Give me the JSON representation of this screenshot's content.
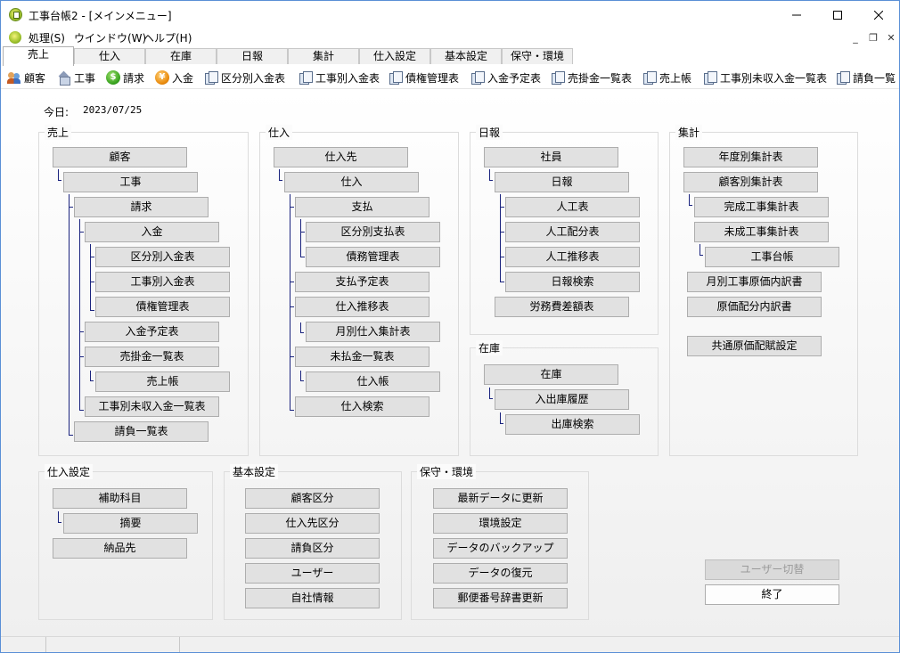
{
  "window": {
    "title": "工事台帳2 - [メインメニュー]"
  },
  "menu": {
    "items": [
      "処理(S)",
      "ウインドウ(W)",
      "ヘルプ(H)"
    ]
  },
  "tabs": [
    "売上",
    "仕入",
    "在庫",
    "日報",
    "集計",
    "仕入設定",
    "基本設定",
    "保守・環境"
  ],
  "toolbar": [
    "顧客",
    "工事",
    "請求",
    "入金",
    "区分別入金表",
    "工事別入金表",
    "債権管理表",
    "入金予定表",
    "売掛金一覧表",
    "売上帳",
    "工事別未収入金一覧表",
    "請負一覧"
  ],
  "date": {
    "label": "今日:",
    "value": "2023/07/25"
  },
  "groups": {
    "uriage": {
      "title": "売上",
      "buttons": [
        "顧客",
        "工事",
        "請求",
        "入金",
        "区分別入金表",
        "工事別入金表",
        "債権管理表",
        "入金予定表",
        "売掛金一覧表",
        "売上帳",
        "工事別未収入金一覧表",
        "請負一覧表"
      ]
    },
    "shiire": {
      "title": "仕入",
      "buttons": [
        "仕入先",
        "仕入",
        "支払",
        "区分別支払表",
        "債務管理表",
        "支払予定表",
        "仕入推移表",
        "月別仕入集計表",
        "未払金一覧表",
        "仕入帳",
        "仕入検索"
      ]
    },
    "nippo": {
      "title": "日報",
      "buttons": [
        "社員",
        "日報",
        "人工表",
        "人工配分表",
        "人工推移表",
        "日報検索",
        "労務費差額表"
      ]
    },
    "zaiko": {
      "title": "在庫",
      "buttons": [
        "在庫",
        "入出庫履歴",
        "出庫検索"
      ]
    },
    "shukei": {
      "title": "集計",
      "buttons": [
        "年度別集計表",
        "顧客別集計表",
        "完成工事集計表",
        "未成工事集計表",
        "工事台帳",
        "月別工事原価内訳書",
        "原価配分内訳書",
        "共通原価配賦設定"
      ]
    },
    "shiire_settei": {
      "title": "仕入設定",
      "buttons": [
        "補助科目",
        "摘要",
        "納品先"
      ]
    },
    "kihon_settei": {
      "title": "基本設定",
      "buttons": [
        "顧客区分",
        "仕入先区分",
        "請負区分",
        "ユーザー",
        "自社情報"
      ]
    },
    "hoshu": {
      "title": "保守・環境",
      "buttons": [
        "最新データに更新",
        "環境設定",
        "データのバックアップ",
        "データの復元",
        "郵便番号辞書更新"
      ]
    }
  },
  "actions": {
    "switch_user": "ユーザー切替",
    "exit": "終了"
  }
}
